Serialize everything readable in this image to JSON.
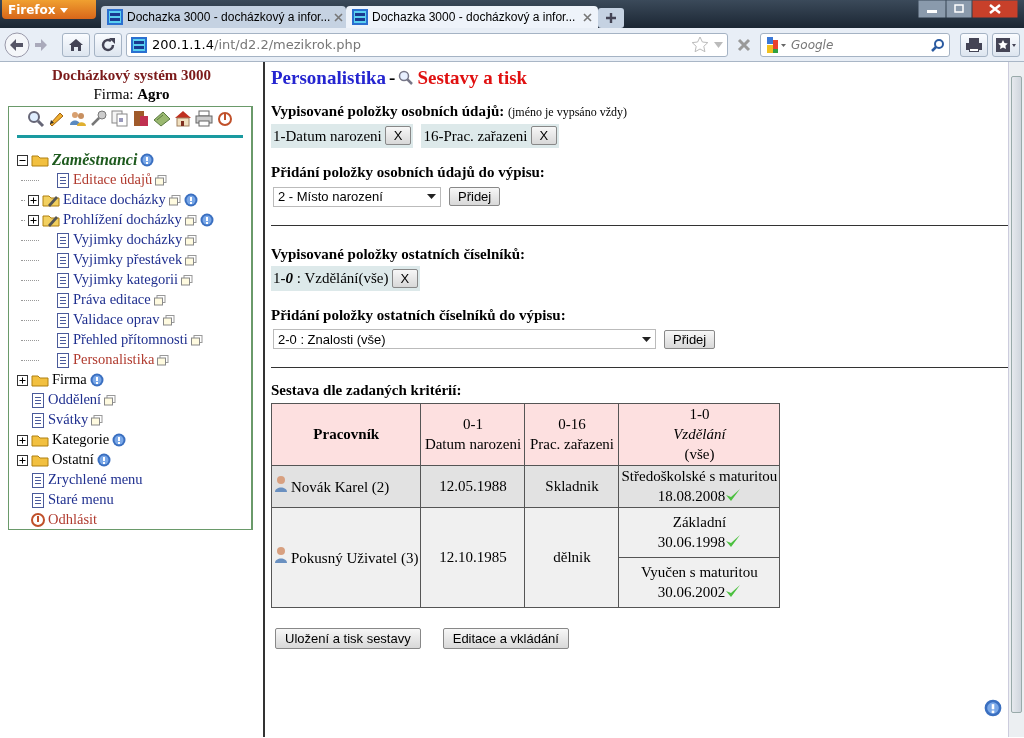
{
  "browser": {
    "menu_button": "Firefox",
    "tabs": [
      {
        "title": "Dochazka 3000 - docházkový a infor...",
        "selected": false
      },
      {
        "title": "Dochazka 3000 - docházkový a infor...",
        "selected": true
      }
    ],
    "url_host": "200.1.1.4",
    "url_path": "/int/d2.2/mezikrok.php",
    "search_placeholder": "Google"
  },
  "sidebar": {
    "title": "Docházkový systém 3000",
    "company": "Firma: **Agro**",
    "tree": [
      {
        "kind": "folder",
        "label": "Zaměstnanci",
        "color": "#1e5a1e",
        "expanded": true,
        "help": true,
        "window": false,
        "children": [
          {
            "kind": "page",
            "label": "Editace údajů",
            "color": "#b03a2e",
            "window": true,
            "help": false
          },
          {
            "kind": "folder-edit",
            "label": "Editace docházky",
            "color": "#1f2f8f",
            "expanded": false,
            "window": true,
            "help": true
          },
          {
            "kind": "folder-edit",
            "label": "Prohlížení docházky",
            "color": "#1f2f8f",
            "expanded": false,
            "window": true,
            "help": true
          },
          {
            "kind": "page",
            "label": "Vyjimky docházky",
            "color": "#1f2f8f",
            "window": true,
            "help": false
          },
          {
            "kind": "page",
            "label": "Vyjimky přestávek",
            "color": "#1f2f8f",
            "window": true,
            "help": false
          },
          {
            "kind": "page",
            "label": "Vyjimky kategorii",
            "color": "#1f2f8f",
            "window": true,
            "help": false
          },
          {
            "kind": "page",
            "label": "Práva editace",
            "color": "#1f2f8f",
            "window": true,
            "help": false
          },
          {
            "kind": "page",
            "label": "Validace oprav",
            "color": "#1f2f8f",
            "window": true,
            "help": false
          },
          {
            "kind": "page",
            "label": "Přehled přítomnosti",
            "color": "#1f2f8f",
            "window": true,
            "help": false
          },
          {
            "kind": "page",
            "label": "Personalistika",
            "color": "#b03a2e",
            "window": true,
            "help": false
          }
        ]
      },
      {
        "kind": "folder",
        "label": "Firma",
        "color": "#000000",
        "expanded": false,
        "help": true,
        "window": false
      },
      {
        "kind": "page",
        "label": "Oddělení",
        "color": "#1f2f8f",
        "window": true,
        "help": false
      },
      {
        "kind": "page",
        "label": "Svátky",
        "color": "#1f2f8f",
        "window": true,
        "help": false
      },
      {
        "kind": "folder",
        "label": "Kategorie",
        "color": "#000000",
        "expanded": false,
        "help": true,
        "window": false
      },
      {
        "kind": "folder",
        "label": "Ostatní",
        "color": "#000000",
        "expanded": false,
        "help": true,
        "window": false
      },
      {
        "kind": "page",
        "label": "Zrychlené menu",
        "color": "#1f2f8f",
        "window": false,
        "help": false
      },
      {
        "kind": "page",
        "label": "Staré menu",
        "color": "#1f2f8f",
        "window": false,
        "help": false
      },
      {
        "kind": "logout",
        "label": "Odhlásit",
        "color": "#b03a2e",
        "window": false,
        "help": false
      }
    ]
  },
  "main": {
    "title": "Personalistika",
    "separator": "-",
    "subtitle": "Sestavy a tisk",
    "personal": {
      "heading": "Vypisované položky osobních údajů:",
      "note": "(jméno je vypsáno vždy)",
      "chips": [
        {
          "label": "1-Datum narozeni",
          "remove": "X"
        },
        {
          "label": "16-Prac. zařazeni",
          "remove": "X"
        }
      ]
    },
    "personal_add": {
      "heading": "Přidání položky osobních údajů do výpisu:",
      "select": "2 - Místo narození",
      "button": "Přidej"
    },
    "other": {
      "heading": "Vypisované položky ostatních číselníků:",
      "chips": [
        {
          "label": "1-**0** : Vzdělání(vše)",
          "remove": "X"
        }
      ]
    },
    "other_add": {
      "heading": "Přidání položky ostatních číselníků do výpisu:",
      "select": "2-0 : Znalosti (vše)",
      "button": "Přidej"
    },
    "report": {
      "heading": "Sestava dle zadaných kritérií:",
      "columns": [
        [
          "**Pracovník**"
        ],
        [
          "0-1",
          "Datum narozeni"
        ],
        [
          "0-16",
          "Prac. zařazeni"
        ],
        [
          "1-0",
          "*Vzdělání*",
          "(vše)"
        ]
      ],
      "rows": [
        {
          "name": "Novák Karel (2)",
          "birth": "12.05.1988",
          "position": "Skladnik",
          "education": [
            {
              "name": "Středoškolské s maturitou",
              "date": "18.08.2008",
              "valid": true
            }
          ]
        },
        {
          "name": "Pokusný Uživatel (3)",
          "birth": "12.10.1985",
          "position": "dělnik",
          "education": [
            {
              "name": "Základní",
              "date": "30.06.1998",
              "valid": true
            },
            {
              "name": "Vyučen s maturitou",
              "date": "30.06.2002",
              "valid": true
            }
          ]
        }
      ]
    },
    "buttons": [
      "Uložení a tisk sestavy",
      "Editace a vkládání"
    ]
  }
}
